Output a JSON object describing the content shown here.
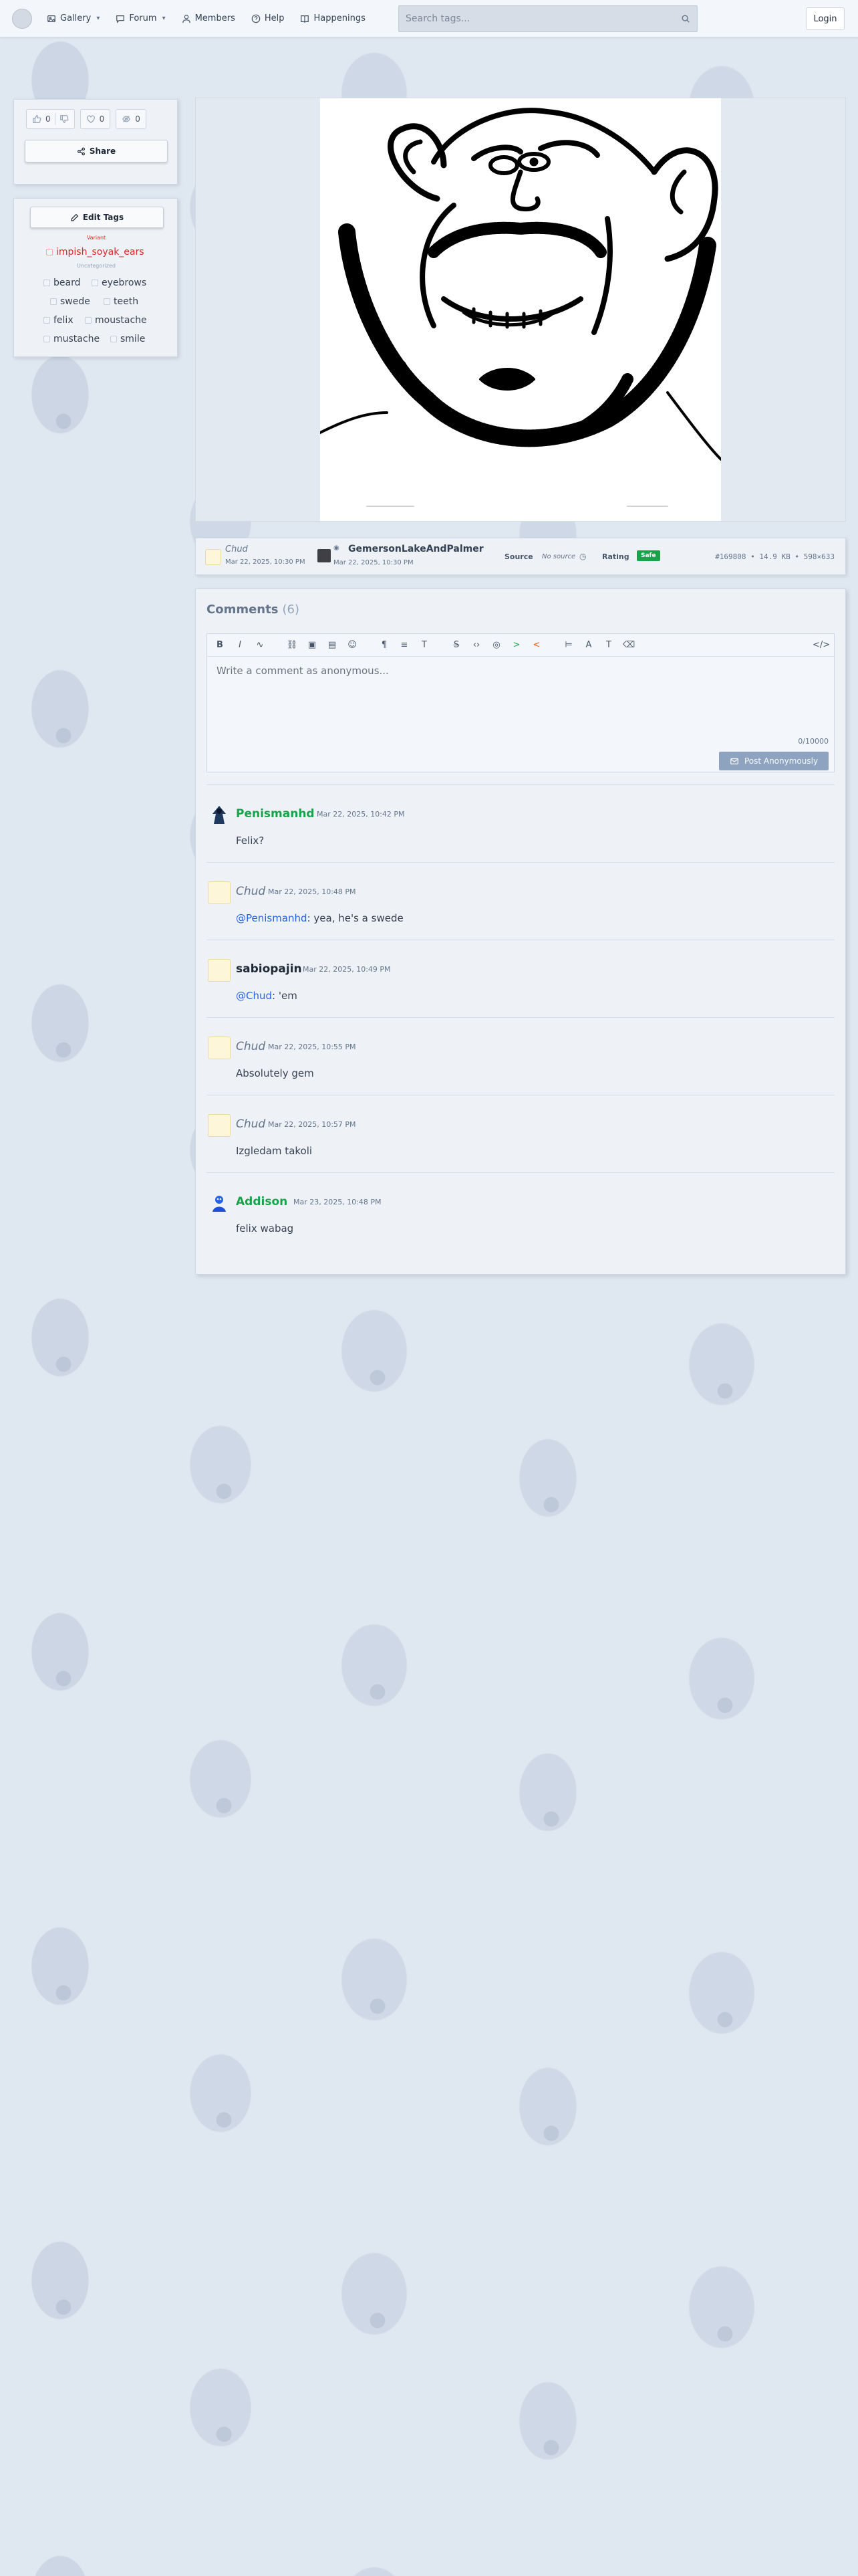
{
  "nav": {
    "gallery": "Gallery",
    "forum": "Forum",
    "members": "Members",
    "help": "Help",
    "happenings": "Happenings",
    "search_placeholder": "Search tags...",
    "login": "Login"
  },
  "votes": {
    "upvotes": "0",
    "favorites": "0",
    "hides": "0"
  },
  "share_label": "Share",
  "tags": {
    "edit_label": "Edit Tags",
    "variant_heading": "Variant",
    "variant": [
      "impish_soyak_ears"
    ],
    "uncategorized_heading": "Uncategorized",
    "uncategorized": [
      "beard",
      "eyebrows",
      "swede",
      "teeth",
      "felix",
      "moustache",
      "mustache",
      "smile"
    ]
  },
  "info": {
    "uploader": "Chud",
    "uploader_date": "Mar 22, 2025, 10:30 PM",
    "artist": "GemersonLakeAndPalmer",
    "artist_date": "Mar 22, 2025, 10:30 PM",
    "source_label": "Source",
    "source_value": "No source",
    "rating_label": "Rating",
    "rating_value": "Safe",
    "meta": "#169808 • 14.9 KB • 598×633"
  },
  "comments": {
    "title": "Comments",
    "count": "(6)",
    "placeholder": "Write a comment as anonymous...",
    "char_count": "0/10000",
    "post_label": "Post Anonymously",
    "items": [
      {
        "author": "Penismanhd",
        "date": "Mar 22, 2025, 10:42 PM",
        "body": "Felix?"
      },
      {
        "author": "Chud",
        "date": "Mar 22, 2025, 10:48 PM",
        "mention": "@Penismanhd",
        "body": ": yea, he's a swede"
      },
      {
        "author": "sabiopajin",
        "date": "Mar 22, 2025, 10:49 PM",
        "mention": "@Chud",
        "body": ": 'em"
      },
      {
        "author": "Chud",
        "date": "Mar 22, 2025, 10:55 PM",
        "body": "Absolutely gem"
      },
      {
        "author": "Chud",
        "date": "Mar 22, 2025, 10:57 PM",
        "body": "Izgledam takoli"
      },
      {
        "author": "Addison",
        "date": "Mar 23, 2025, 10:48 PM",
        "body": "felix wabag"
      }
    ]
  }
}
